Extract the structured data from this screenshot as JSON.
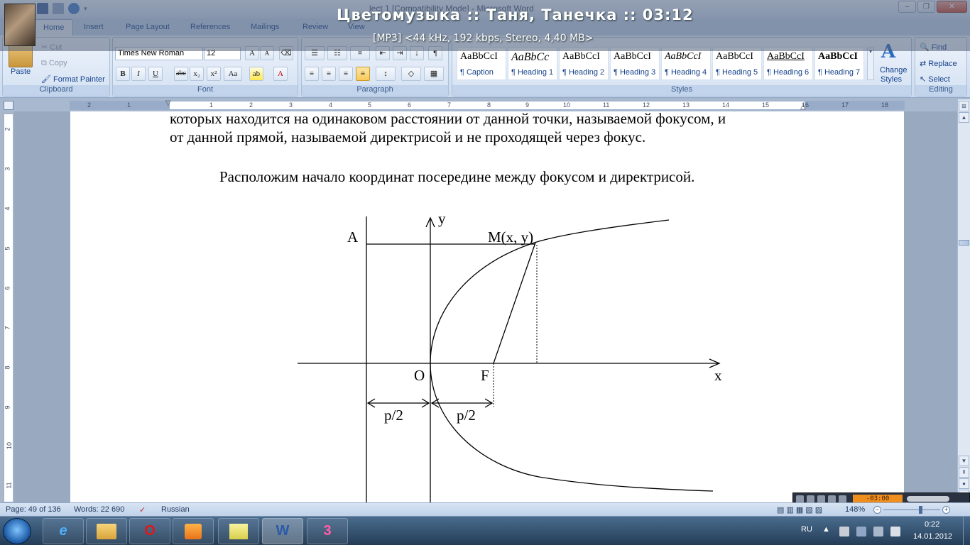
{
  "window": {
    "title": "lect 1 [Compatibility Mode] - Microsoft Word",
    "minimize": "–",
    "restore": "❐",
    "close": "✕"
  },
  "overlay": {
    "track": "Цветомузыка :: Таня, Танечка :: 03:12",
    "info": "[MP3] <44 kHz, 192 kbps, Stereo, 4,40 MB>"
  },
  "ribbon": {
    "tabs": [
      "Home",
      "Insert",
      "Page Layout",
      "References",
      "Mailings",
      "Review",
      "View"
    ],
    "clipboard": {
      "paste": "Paste",
      "cut": "Cut",
      "copy": "Copy",
      "format_painter": "Format Painter",
      "label": "Clipboard"
    },
    "font": {
      "name": "Times New Roman",
      "size": "12",
      "label": "Font",
      "bold": "B",
      "italic": "I",
      "underline": "U",
      "strike": "abc",
      "sub": "x₂",
      "sup": "x²",
      "case": "Aa",
      "grow": "A",
      "shrink": "A"
    },
    "paragraph": {
      "label": "Paragraph",
      "pilcrow": "¶"
    },
    "styles": {
      "label": "Styles",
      "items": [
        {
          "sample": "AaBbCcI",
          "name": "¶ Caption"
        },
        {
          "sample": "AaBbCc",
          "name": "¶ Heading 1"
        },
        {
          "sample": "AaBbCcI",
          "name": "¶ Heading 2"
        },
        {
          "sample": "AaBbCcI",
          "name": "¶ Heading 3"
        },
        {
          "sample": "AaBbCcI",
          "name": "¶ Heading 4"
        },
        {
          "sample": "AaBbCcI",
          "name": "¶ Heading 5"
        },
        {
          "sample": "AaBbCcI",
          "name": "¶ Heading 6"
        },
        {
          "sample": "AaBbCcI",
          "name": "¶ Heading 7"
        }
      ],
      "change_styles_1": "Change",
      "change_styles_2": "Styles"
    },
    "editing": {
      "find": "Find",
      "replace": "Replace",
      "select": "Select",
      "label": "Editing"
    }
  },
  "ruler": {
    "numbers": [
      "2",
      "1",
      "1",
      "2",
      "3",
      "4",
      "5",
      "6",
      "7",
      "8",
      "9",
      "10",
      "11",
      "12",
      "13",
      "14",
      "15",
      "16",
      "17",
      "18"
    ],
    "vnumbers": [
      "2",
      "3",
      "4",
      "5",
      "6",
      "7",
      "8",
      "9",
      "10",
      "11"
    ]
  },
  "document": {
    "line1": "которых находится на одинаковом расстоянии от данной точки, называемой фокусом, и",
    "line2": "от данной прямой, называемой директрисой и не проходящей через фокус.",
    "line3": "Расположим начало координат посередине между фокусом и директрисой.",
    "figure": {
      "label_y": "y",
      "label_x": "x",
      "label_a": "A",
      "label_m": "M(x, y)",
      "label_o": "O",
      "label_f": "F",
      "label_p1": "p/2",
      "label_p2": "p/2"
    }
  },
  "statusbar": {
    "page": "Page: 49 of 136",
    "words": "Words: 22 690",
    "language": "Russian",
    "zoom": "148%"
  },
  "player": {
    "time": "-03:00"
  },
  "taskbar": {
    "lang": "RU",
    "time": "0:22",
    "date": "14.01.2012",
    "apps": [
      "e",
      "",
      "O",
      "",
      "",
      "W",
      "3"
    ]
  }
}
